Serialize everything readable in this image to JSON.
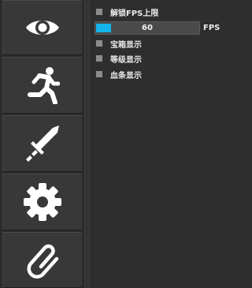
{
  "sidebar": {
    "items": [
      {
        "icon": "eye-icon"
      },
      {
        "icon": "running-man-icon"
      },
      {
        "icon": "sword-icon"
      },
      {
        "icon": "gear-icon"
      },
      {
        "icon": "paperclip-icon"
      }
    ]
  },
  "panel": {
    "unlock_fps": {
      "label": "解锁FPS上限",
      "checked": false
    },
    "fps_slider": {
      "value": "60",
      "unit": "FPS",
      "fill_fraction": 0.1
    },
    "chest_display": {
      "label": "宝箱显示",
      "checked": false
    },
    "level_display": {
      "label": "等级显示",
      "checked": false
    },
    "health_display": {
      "label": "血条显示",
      "checked": false
    }
  },
  "colors": {
    "accent": "#15b4ea",
    "icon": "#ffffff",
    "checkbox": "#8c8c8c"
  }
}
